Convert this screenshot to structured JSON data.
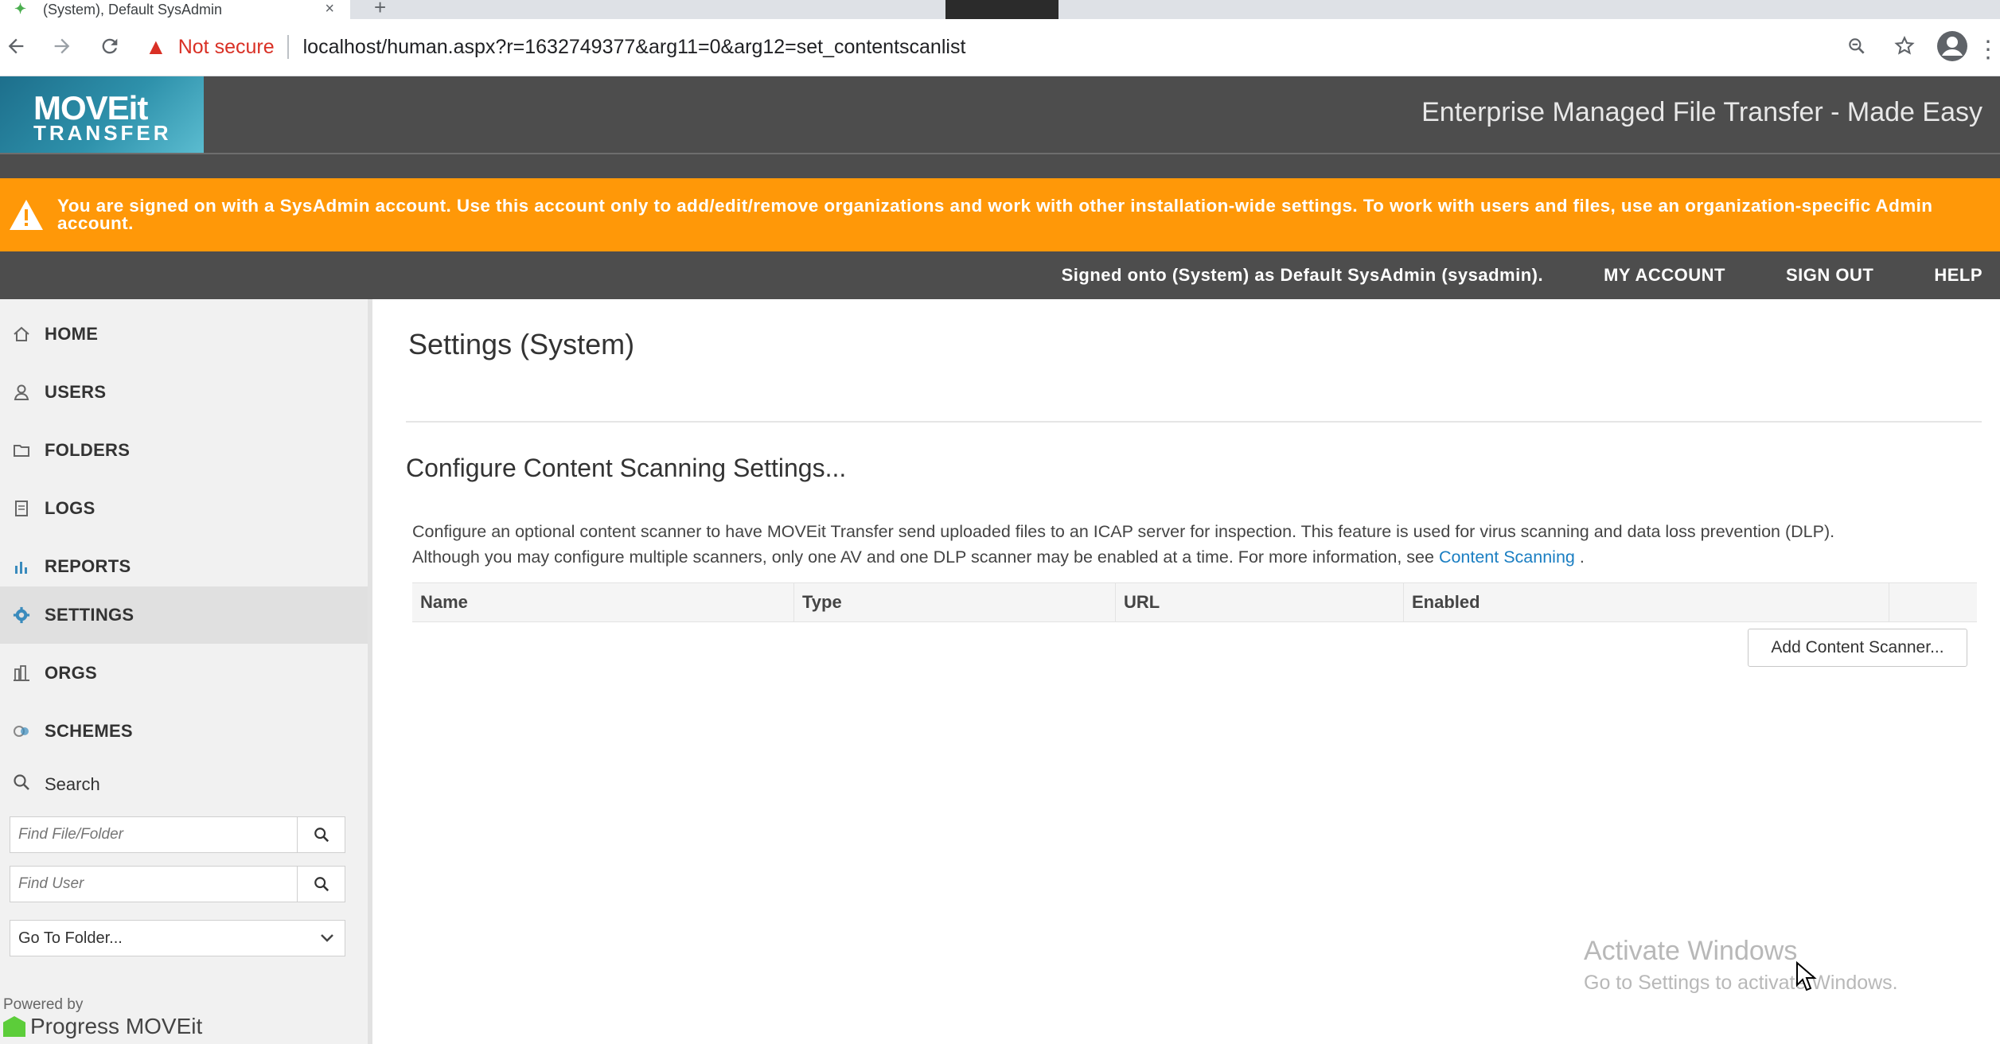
{
  "browser": {
    "tab_title": "(System), Default SysAdmin",
    "close_glyph": "×",
    "newtab_glyph": "+",
    "not_secure": "Not secure",
    "url": "localhost/human.aspx?r=1632749377&arg11=0&arg12=set_contentscanlist",
    "icons": [
      "back-icon",
      "forward-icon",
      "reload-icon",
      "warning-icon",
      "zoom-icon",
      "star-icon",
      "profile-icon",
      "menu-icon"
    ]
  },
  "header": {
    "logo_main": "MOVEit",
    "logo_sub": "TRANSFER",
    "tagline": "Enterprise Managed File Transfer - Made Easy"
  },
  "banner": {
    "text": "You are signed on with a SysAdmin account. Use this account only to add/edit/remove organizations and work with other installation-wide settings. To work with users and files, use an organization-specific Admin account.",
    "color": "#ff9808"
  },
  "signbar": {
    "signed_text": "Signed onto (System) as Default SysAdmin (sysadmin).",
    "my_account": "MY ACCOUNT",
    "sign_out": "SIGN OUT",
    "help": "HELP"
  },
  "sidebar": {
    "items": [
      {
        "label": "HOME",
        "icon": "home-icon"
      },
      {
        "label": "USERS",
        "icon": "user-icon"
      },
      {
        "label": "FOLDERS",
        "icon": "folder-icon"
      },
      {
        "label": "LOGS",
        "icon": "log-icon"
      },
      {
        "label": "REPORTS",
        "icon": "reports-icon"
      },
      {
        "label": "SETTINGS",
        "icon": "gear-icon",
        "active": true
      },
      {
        "label": "ORGS",
        "icon": "orgs-icon"
      },
      {
        "label": "SCHEMES",
        "icon": "schemes-icon"
      }
    ],
    "search_label": "Search",
    "find_file_placeholder": "Find File/Folder",
    "find_user_placeholder": "Find User",
    "goto_folder": "Go To Folder...",
    "powered_by": "Powered by",
    "progress_logo": "Progress MOVEit"
  },
  "main": {
    "page_title": "Settings (System)",
    "section_title": "Configure Content Scanning Settings...",
    "description_1": "Configure an optional content scanner to have MOVEit Transfer send uploaded files to an ICAP server for inspection. This feature is used for virus scanning and data loss prevention (DLP).",
    "description_2": "Although you may configure multiple scanners, only one AV and one DLP scanner may be enabled at a time. For more information, see",
    "description_link": "Content Scanning",
    "description_end": ".",
    "table_headers": [
      "Name",
      "Type",
      "URL",
      "Enabled",
      ""
    ],
    "add_button": "Add Content Scanner..."
  },
  "watermark": {
    "line1": "Activate Windows",
    "line2": "Go to Settings to activate Windows."
  }
}
